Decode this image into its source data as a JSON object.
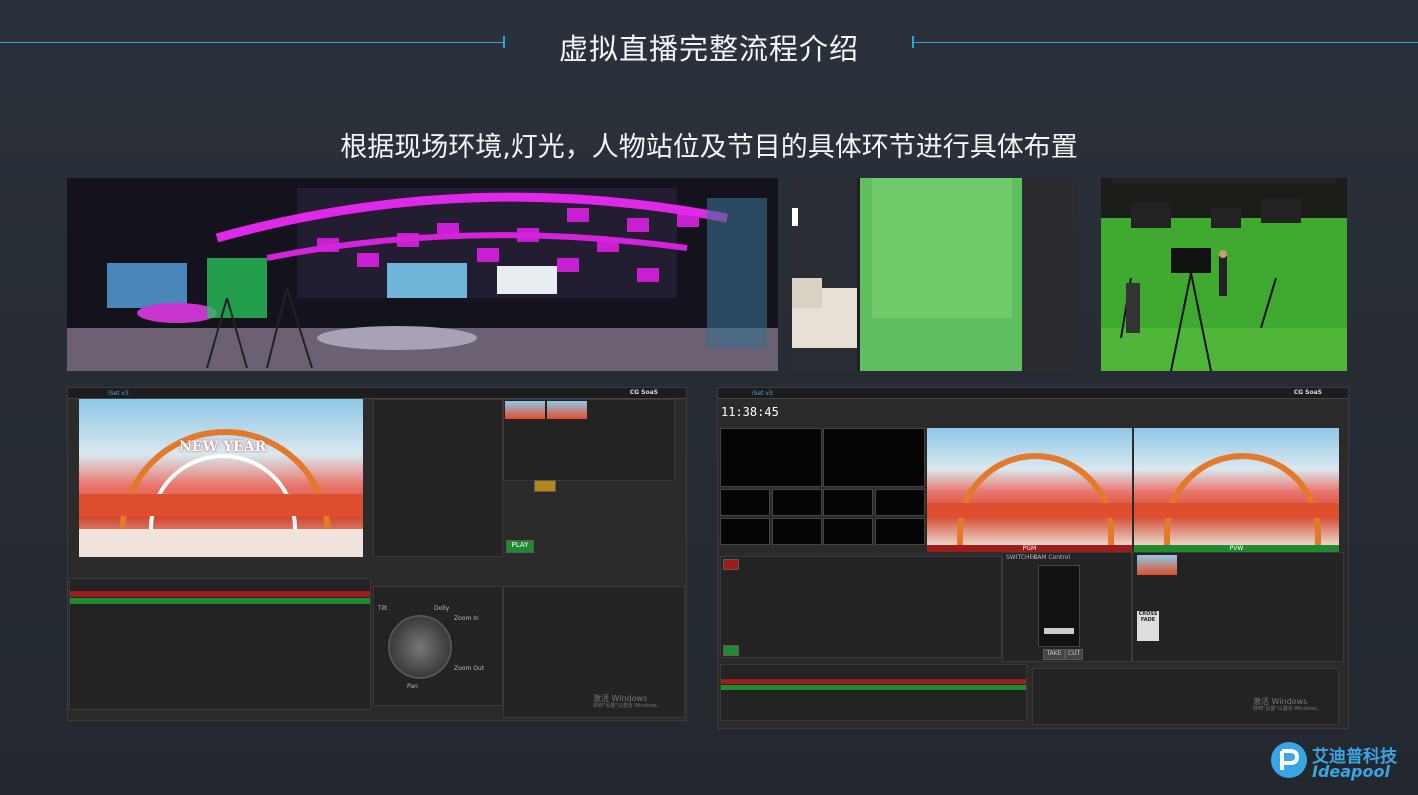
{
  "header": {
    "title": "虚拟直播完整流程介绍"
  },
  "subtitle": "根据现场环境,灯光，人物站位及节目的具体环节进行具体布置",
  "colors": {
    "accent": "#2aa7d6",
    "brand": "#3aa5e3",
    "background": "#282d35"
  },
  "photos": [
    {
      "name": "studio-panorama"
    },
    {
      "name": "green-screen-corner"
    },
    {
      "name": "green-screen-studio"
    }
  ],
  "screenshot_left": {
    "app_title": "iSet v3",
    "brand": "CG SoaS",
    "program_title": "NEW YEAR",
    "watermark_line1": "激活 Windows",
    "watermark_line2": "转到\"设置\"以激活 Windows。",
    "play_label": "PLAY",
    "ptz_tilt": "Tilt",
    "ptz_dolly": "Dolly",
    "ptz_pan": "Pan",
    "zoom_in": "Zoom In",
    "zoom_out": "Zoom Out"
  },
  "screenshot_right": {
    "app_title": "iSet v3",
    "brand": "CG SoaS",
    "clock": "11:38:45",
    "pgm_label": "PGM",
    "pvw_label": "PVW",
    "switcher_tab": "SWITCHER",
    "cam_tab": "CAM Control",
    "take_label": "TAKE",
    "cut_label": "CUT",
    "crossfade_label": "CROSS FADE",
    "watermark_line1": "激活 Windows",
    "watermark_line2": "转到\"设置\"以激活 Windows。"
  },
  "footer": {
    "brand_cn": "艾迪普科技",
    "brand_en": "Ideapool"
  }
}
